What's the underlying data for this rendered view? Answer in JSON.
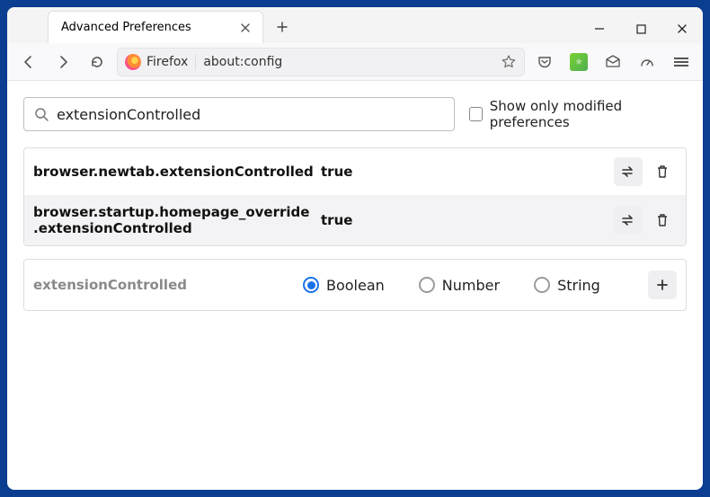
{
  "tab": {
    "title": "Advanced Preferences"
  },
  "addr": {
    "prefix": "Firefox",
    "url": "about:config"
  },
  "search": {
    "value": "extensionControlled",
    "show_only_modified_label": "Show only modified preferences"
  },
  "prefs": [
    {
      "name": "browser.newtab.extensionControlled",
      "value": "true"
    },
    {
      "name": "browser.startup.homepage_override.extensionControlled",
      "value": "true"
    }
  ],
  "add": {
    "name": "extensionControlled",
    "types": {
      "boolean": "Boolean",
      "number": "Number",
      "string": "String"
    },
    "selected": "boolean"
  }
}
